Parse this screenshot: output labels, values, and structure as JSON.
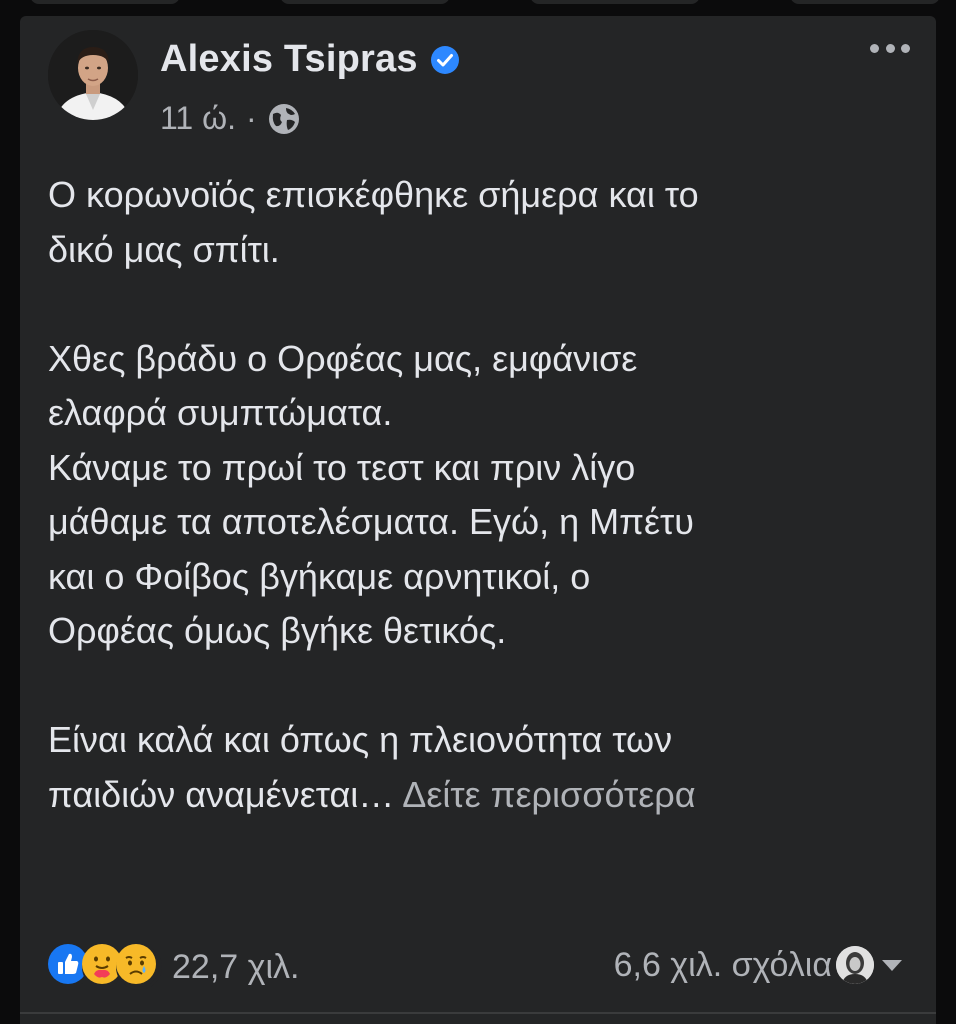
{
  "post": {
    "author": "Alexis Tsipras",
    "verified": true,
    "time": "11 ώ.",
    "separator": "·",
    "privacy_icon": "globe-icon",
    "more_icon": "more-horizontal-icon",
    "paragraphs": [
      "Ο κορωνοϊός επισκέφθηκε σήμερα και το\nδικό μας σπίτι.",
      "Χθες βράδυ ο Ορφέας μας, εμφάνισε\nελαφρά συμπτώματα.\nΚάναμε το πρωί το τεστ και πριν λίγο\nμάθαμε τα αποτελέσματα. Εγώ, η Μπέτυ\nκαι ο Φοίβος βγήκαμε αρνητικοί, ο\nΟρφέας όμως βγήκε θετικός.",
      "Είναι καλά και όπως η πλειονότητα των\nπαιδιών αναμένεται…"
    ],
    "see_more": "Δείτε περισσότερα"
  },
  "footer": {
    "reaction_icons": [
      "like-icon",
      "care-icon",
      "sad-icon"
    ],
    "reaction_count": "22,7 χιλ.",
    "comment_count": "6,6 χιλ. σχόλια",
    "commenter_avatar": "commenter-avatar",
    "dropdown_icon": "caret-down-icon"
  },
  "colors": {
    "background": "#242526",
    "text": "#e4e6eb",
    "secondary_text": "#b0b3b8",
    "verified_blue": "#2d88ff",
    "like_blue": "#1877f2",
    "care_yellow": "#f7b928",
    "heart_red": "#f33e58"
  }
}
